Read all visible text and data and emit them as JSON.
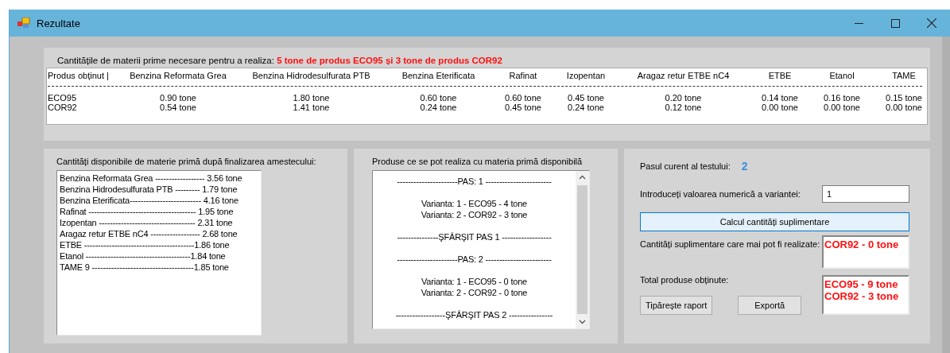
{
  "window": {
    "title": "Rezultate"
  },
  "requirements": {
    "heading": "Cantitățile de materii prime necesare pentru a realiza: **5 tone de produs ECO95  și 3 tone de produs COR92**",
    "columns": [
      "Produs obținut  |",
      "Benzina Reformata Grea",
      "Benzina Hidrodesulfurata PTB",
      "Benzina Eterificata",
      "Rafinat",
      "Izopentan",
      "Aragaz retur ETBE nC4",
      "ETBE",
      "Etanol",
      "TAME"
    ],
    "rows": [
      [
        "ECO95",
        "0.90 tone",
        "1.80 tone",
        "0.60 tone",
        "0.60 tone",
        "0.45 tone",
        "0.20 tone",
        "0.14 tone",
        "0.16 tone",
        "0.15 tone"
      ],
      [
        "COR92",
        "0.54 tone",
        "1.41 tone",
        "0.24 tone",
        "0.45 tone",
        "0.24 tone",
        "0.12 tone",
        "0.00 tone",
        "0.00 tone",
        "0.00 tone"
      ]
    ]
  },
  "available": {
    "heading": "Cantități disponibile de materie primă după finalizarea amestecului:",
    "lines": [
      "Benzina Reformata Grea ------------------ 3.56 tone",
      "Benzina Hidrodesulfurata PTB --------- 1.79 tone",
      "Benzina Eterificata-------------------------- 4.16 tone",
      "Rafinat --------------------------------------- 1.95 tone",
      "Izopentan ----------------------------------- 2.31 tone",
      "Aragaz retur ETBE nC4 ------------------ 2.68 tone",
      "ETBE ----------------------------------------1.86 tone",
      "Etanol --------------------------------------1.84 tone",
      "TAME 9 -------------------------------------1.85 tone"
    ]
  },
  "products": {
    "heading": "Produse ce se pot realiza cu materia primă disponibilă",
    "lines": [
      "----------------------PAS: 1 ------------------------",
      "Varianta: 1 - ECO95 - 4 tone",
      "Varianta: 2 - COR92 - 3 tone",
      "---------------ŞFÂRŞIT PAS 1 ------------------",
      "----------------------PAS: 2 ------------------------",
      "Varianta: 1 - ECO95 - 0 tone",
      "Varianta: 2 - COR92 - 0 tone",
      "------------------ŞFÂRŞIT PAS 2 ----------------"
    ]
  },
  "test": {
    "step_label": "Pasul curent al testului:",
    "step_value": "2",
    "variant_label": "Introduceți valoarea numerică a variantei:",
    "variant_value": "1",
    "calc_button": "Calcul cantități suplimentare",
    "extra_label": "Cantități suplimentare care mai pot fi realizate:",
    "extra_lines": [
      "COR92 - 0 tone"
    ],
    "total_label": "Total produse obținute:",
    "total_lines": [
      "ECO95 - 9 tone",
      "COR92 - 3 tone"
    ],
    "buttons": [
      "Tipărește raport",
      "Exportă"
    ]
  }
}
